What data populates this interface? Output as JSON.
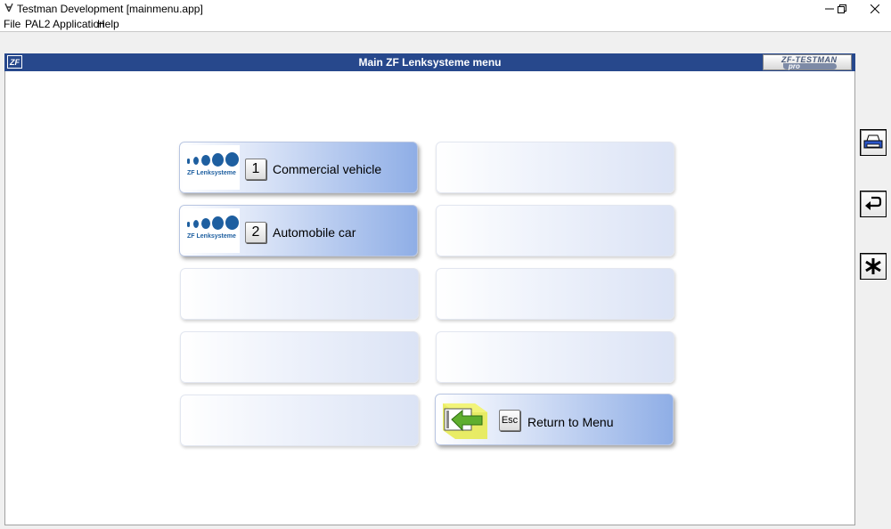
{
  "window": {
    "title": "Testman Development [mainmenu.app]",
    "minimize_glyph": "—",
    "restore_glyph": "restore",
    "close_glyph": "✕"
  },
  "menubar": {
    "items": [
      "File",
      "PAL2 Application",
      "Help"
    ]
  },
  "header": {
    "title": "Main ZF Lenksysteme menu",
    "logo_text": "ZF",
    "badge_text": "ZF-TESTMAN",
    "badge_sub": "pro"
  },
  "tiles": [
    {
      "key": "1",
      "label": "Commercial vehicle",
      "logo_text": "ZF Lenksysteme"
    },
    {
      "key": "2",
      "label": "Automobile car",
      "logo_text": "ZF Lenksysteme"
    },
    {
      "key": "Esc",
      "label": "Return to Menu"
    }
  ],
  "side_buttons": [
    "printer-icon",
    "return-icon",
    "asterisk-icon"
  ],
  "colors": {
    "header_blue": "#27488c",
    "tile_accent": "#8faee6",
    "logo_blue": "#1e5fa0"
  }
}
